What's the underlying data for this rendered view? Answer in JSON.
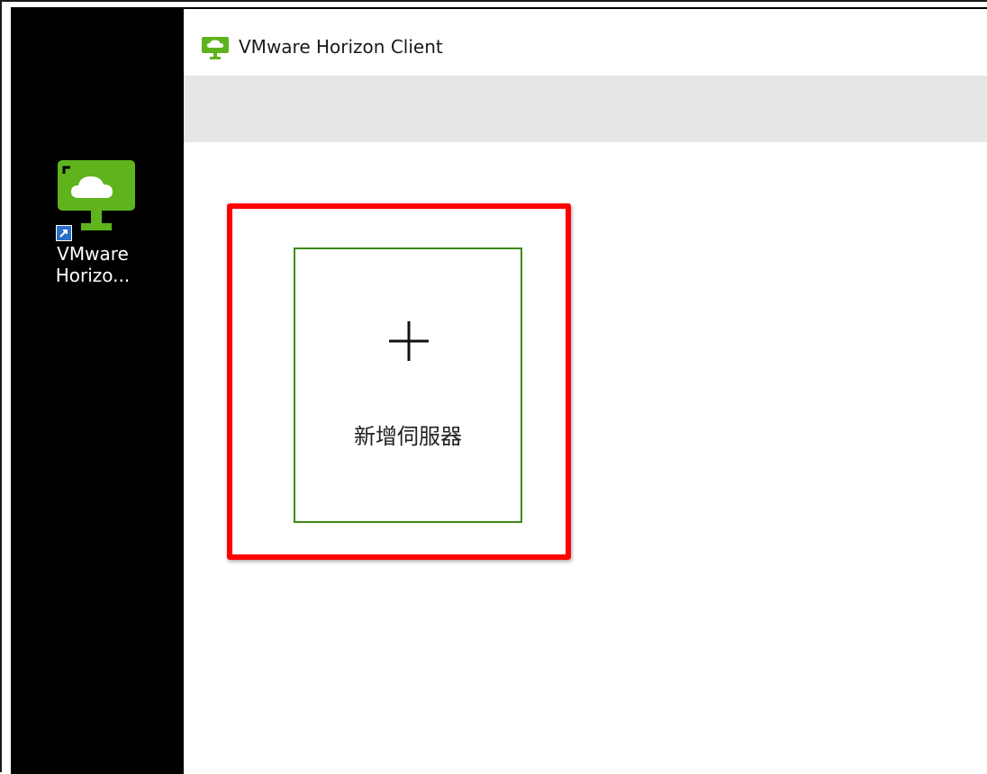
{
  "desktop": {
    "shortcut": {
      "icon": "vmware-horizon-monitor-cloud-icon",
      "label_line1": "VMware",
      "label_line2": "Horizo..."
    }
  },
  "window": {
    "title": "VMware Horizon Client",
    "icon": "vmware-horizon-monitor-icon"
  },
  "main": {
    "add_server": {
      "icon": "plus-icon",
      "label": "新增伺服器"
    }
  },
  "colors": {
    "brand_green": "#5fb41e",
    "tile_border": "#3d8a10",
    "highlight": "#ff0000",
    "toolbar_bg": "#e6e6e6"
  }
}
